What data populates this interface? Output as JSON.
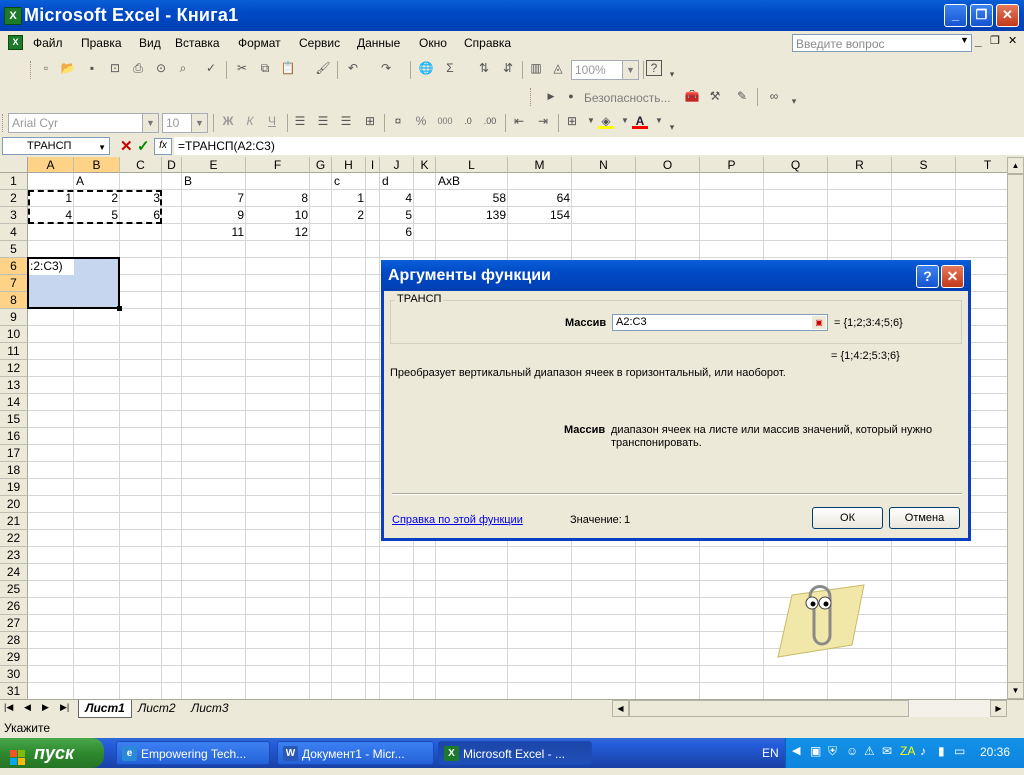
{
  "window": {
    "title": "Microsoft Excel - Книга1",
    "min": "_",
    "max": "❐",
    "close": "✕"
  },
  "menu": {
    "items": [
      "Файл",
      "Правка",
      "Вид",
      "Вставка",
      "Формат",
      "Сервис",
      "Данные",
      "Окно",
      "Справка"
    ],
    "ask_placeholder": "Введите вопрос"
  },
  "toolbar": {
    "zoom": "100%",
    "security": "Безопасность...",
    "font_name": "Arial Cyr",
    "font_size": "10",
    "bold": "Ж",
    "italic": "К",
    "underline": "Ч",
    "percent": "%",
    "thousands": "000"
  },
  "formula_bar": {
    "name_box": "ТРАНСП",
    "cancel": "✕",
    "enter": "✓",
    "fx": "fx",
    "formula": "=ТРАНСП(A2:C3)"
  },
  "columns": [
    "A",
    "B",
    "C",
    "D",
    "E",
    "F",
    "G",
    "H",
    "I",
    "J",
    "K",
    "L",
    "M",
    "N",
    "O",
    "P",
    "Q",
    "R",
    "S",
    "T"
  ],
  "rows": [
    "1",
    "2",
    "3",
    "4",
    "5",
    "6",
    "7",
    "8",
    "9",
    "10",
    "11",
    "12",
    "13",
    "14",
    "15",
    "16",
    "17",
    "18",
    "19",
    "20",
    "21",
    "22",
    "23",
    "24",
    "25",
    "26",
    "27",
    "28",
    "29",
    "30",
    "31"
  ],
  "cells": {
    "B1": "A",
    "E1": "B",
    "H1": "c",
    "J1": "d",
    "L1": "AxB",
    "A2": "1",
    "B2": "2",
    "C2": "3",
    "E2": "7",
    "F2": "8",
    "H2": "1",
    "J2": "4",
    "L2": "58",
    "M2": "64",
    "A3": "4",
    "B3": "5",
    "C3": "6",
    "E3": "9",
    "F3": "10",
    "H3": "2",
    "J3": "5",
    "L3": "139",
    "M3": "154",
    "E4": "11",
    "F4": "12",
    "J4": "6",
    "A6": ":2:C3)"
  },
  "sheet_tabs": [
    "Лист1",
    "Лист2",
    "Лист3"
  ],
  "status": "Укажите",
  "dialog": {
    "title": "Аргументы функции",
    "help": "?",
    "close": "✕",
    "group": "ТРАНСП",
    "arg_label": "Массив",
    "arg_value": "A2:C3",
    "arg_result": "= {1;2;3:4;5;6}",
    "formula_result": "= {1;4:2;5:3;6}",
    "description": "Преобразует вертикальный диапазон ячеек в горизонтальный, или наоборот.",
    "arg_desc_label": "Массив",
    "arg_desc": "диапазон ячеек на листе или массив значений, который нужно транспонировать.",
    "help_link": "Справка по этой функции",
    "value_label": "Значение:",
    "value": "1",
    "ok": "ОК",
    "cancel": "Отмена"
  },
  "taskbar": {
    "start": "пуск",
    "tasks": [
      "Empowering Tech...",
      "Документ1 - Micr...",
      "Microsoft Excel - ..."
    ],
    "lang": "EN",
    "clock": "20:36"
  }
}
